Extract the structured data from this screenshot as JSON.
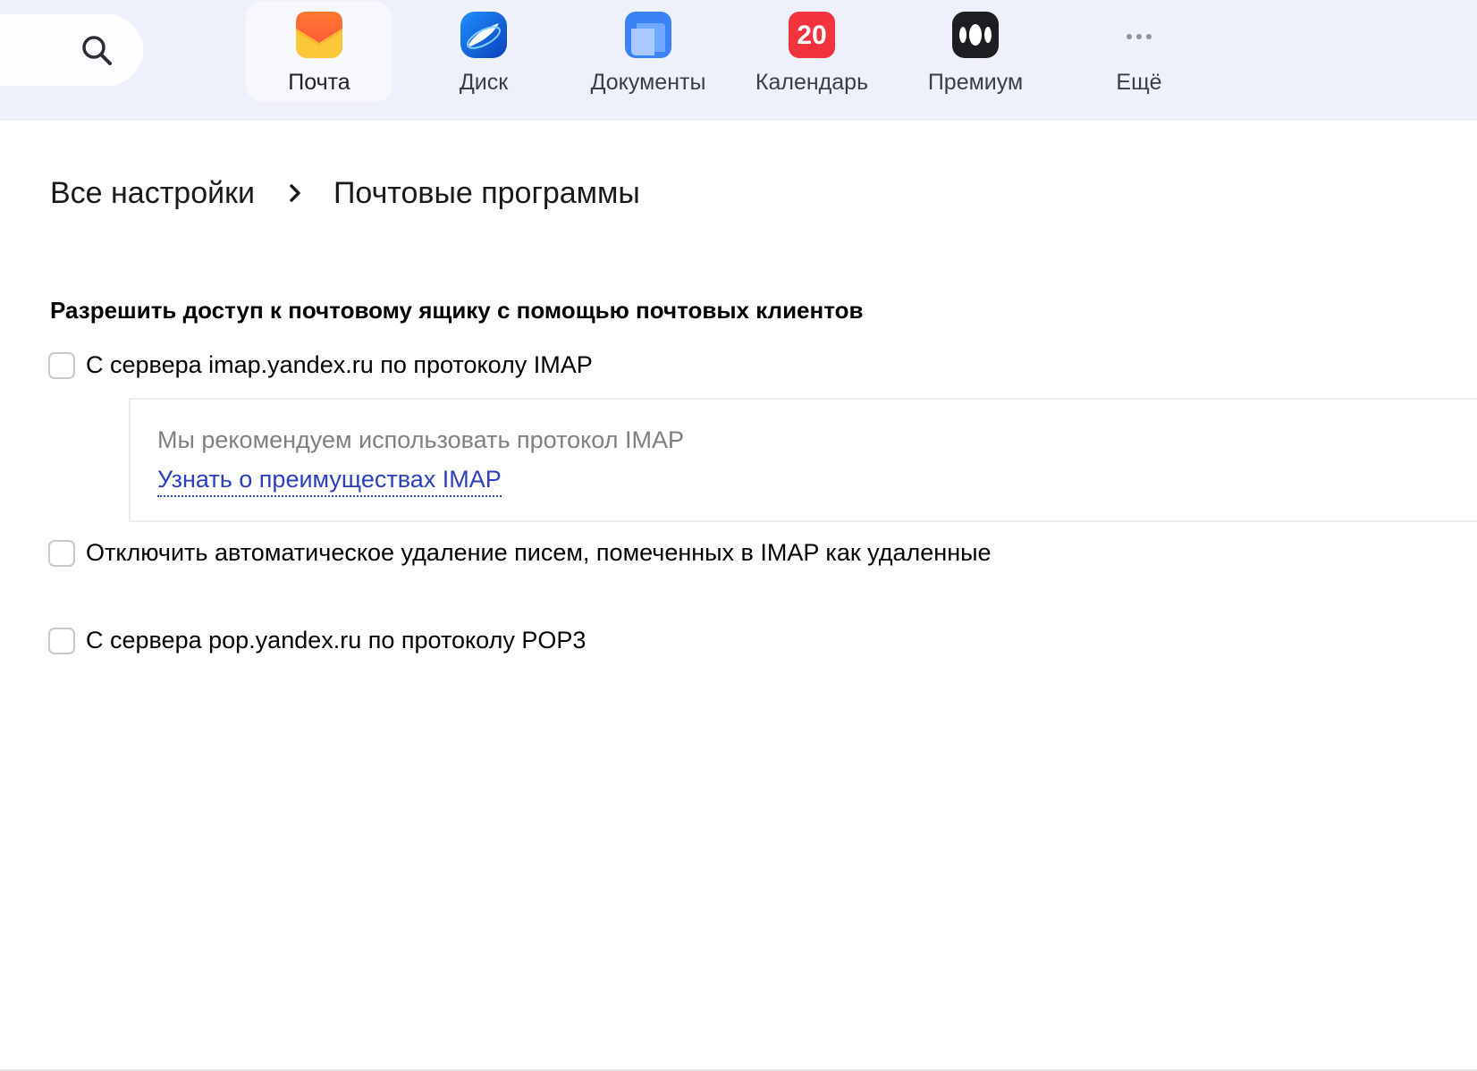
{
  "header": {
    "nav": [
      {
        "label": "Почта",
        "icon": "mail-envelope-icon",
        "active": true
      },
      {
        "label": "Диск",
        "icon": "disk-cloud-icon",
        "active": false
      },
      {
        "label": "Документы",
        "icon": "documents-icon",
        "active": false
      },
      {
        "label": "Календарь",
        "icon": "calendar-icon",
        "badge": "20",
        "active": false
      },
      {
        "label": "Премиум",
        "icon": "premium-icon",
        "active": false
      },
      {
        "label": "Ещё",
        "icon": "more-dots-icon",
        "active": false
      }
    ],
    "search_icon": "search-icon"
  },
  "breadcrumb": {
    "parent": "Все настройки",
    "current": "Почтовые программы"
  },
  "settings": {
    "section_title": "Разрешить доступ к почтовому ящику с помощью почтовых клиентов",
    "imap_option": "С сервера imap.yandex.ru по протоколу IMAP",
    "hint": {
      "text": "Мы рекомендуем использовать протокол IMAP",
      "link": "Узнать о преимуществах IMAP"
    },
    "disable_autodelete_option": "Отключить автоматическое удаление писем, помеченных в IMAP как удаленные",
    "pop3_option": "С сервера pop.yandex.ru по протоколу POP3"
  },
  "colors": {
    "header_bg": "#eef1fb",
    "link": "#2b3fbf",
    "calendar_red": "#f2323c",
    "mail_yellow": "#fcc83a",
    "mail_orange": "#ff6a2f"
  }
}
